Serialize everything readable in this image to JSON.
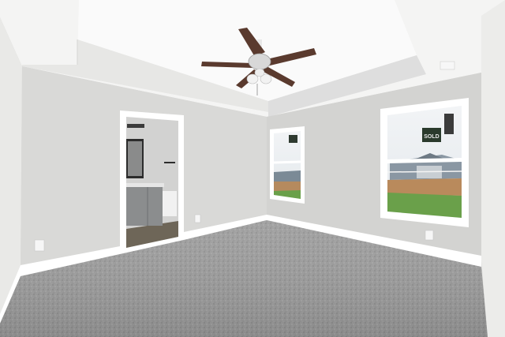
{
  "scene": {
    "subject": "empty-bedroom-interior",
    "colors": {
      "wall_light": "#e4e4e2",
      "wall_mid": "#d6d6d4",
      "wall_shadow": "#c9c9c7",
      "ceiling": "#f3f3f2",
      "trim": "#ffffff",
      "carpet": "#9c9c9c",
      "fan_blade": "#5a3a2e",
      "vanity": "#8b8d8e",
      "lawn": "#6aa04a",
      "dirt": "#b98a5c",
      "sky": "#eef2f5"
    },
    "window_sign_text": "SOLD"
  }
}
